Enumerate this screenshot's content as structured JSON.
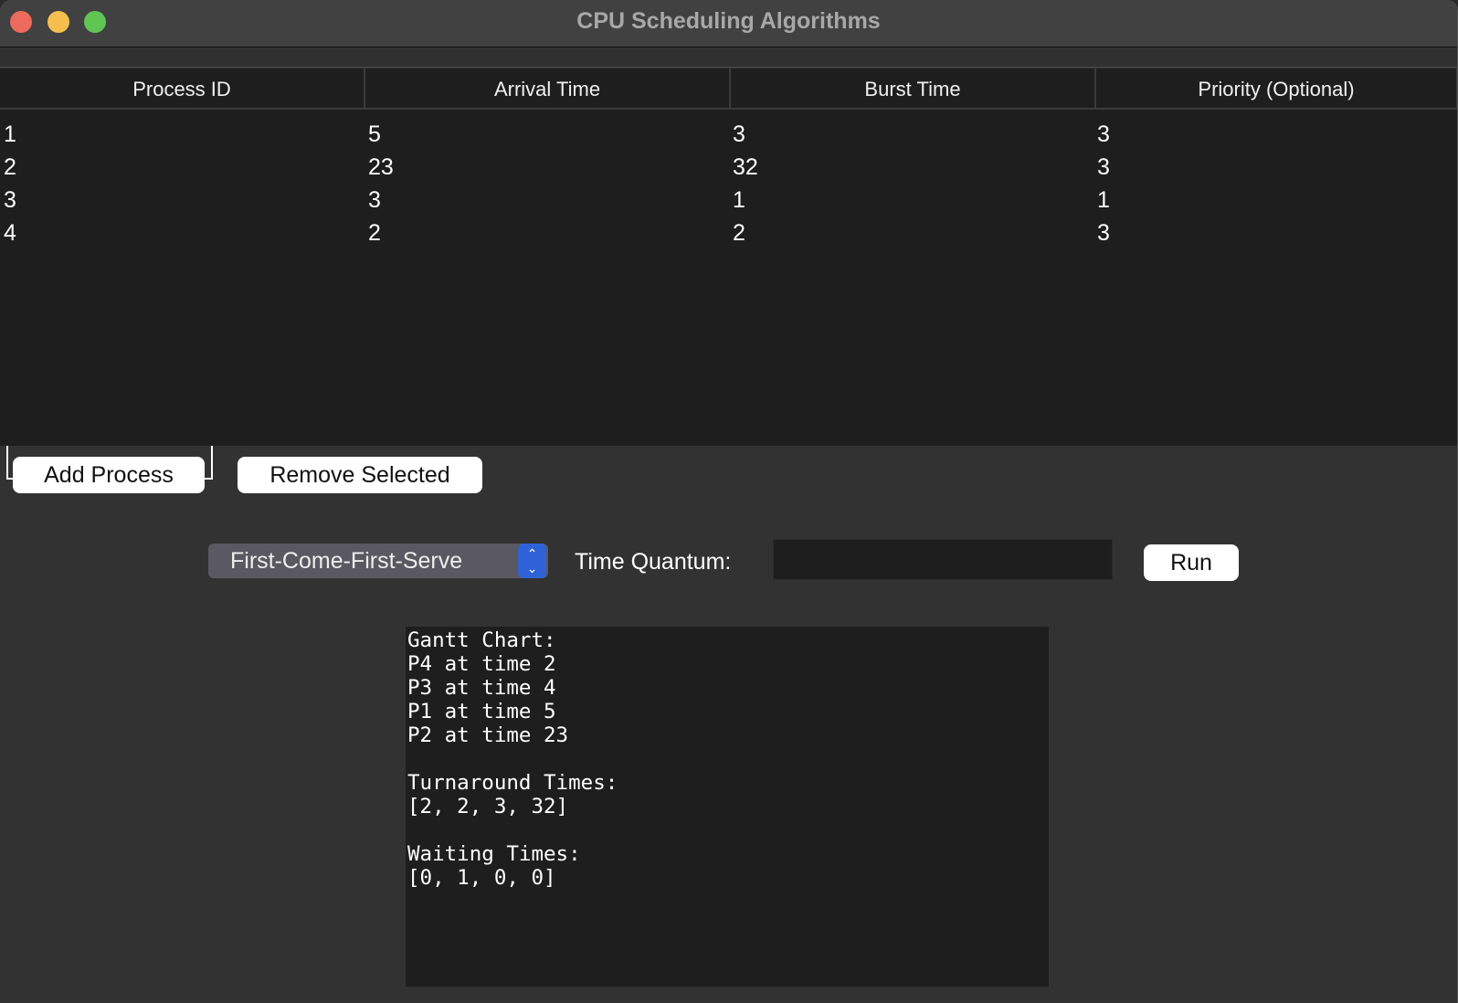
{
  "window": {
    "title": "CPU Scheduling Algorithms",
    "traffic_lights": {
      "close": "#ed6a5e",
      "minimize": "#f5bf4f",
      "maximize": "#61c554"
    }
  },
  "table": {
    "columns": [
      "Process ID",
      "Arrival Time",
      "Burst Time",
      "Priority (Optional)"
    ],
    "rows": [
      [
        "1",
        "5",
        "3",
        "3"
      ],
      [
        "2",
        "23",
        "32",
        "3"
      ],
      [
        "3",
        "3",
        "1",
        "1"
      ],
      [
        "4",
        "2",
        "2",
        "3"
      ]
    ]
  },
  "buttons": {
    "add": "Add Process",
    "remove": "Remove Selected",
    "run": "Run"
  },
  "algorithm": {
    "selected": "First-Come-First-Serve",
    "accent": "#2f62d6"
  },
  "time_quantum": {
    "label": "Time Quantum:",
    "value": ""
  },
  "output": {
    "lines": [
      "Gantt Chart:",
      "P4 at time 2",
      "P3 at time 4",
      "P1 at time 5",
      "P2 at time 23",
      "",
      "Turnaround Times:",
      "[2, 2, 3, 32]",
      "",
      "Waiting Times:",
      "[0, 1, 0, 0]"
    ]
  }
}
